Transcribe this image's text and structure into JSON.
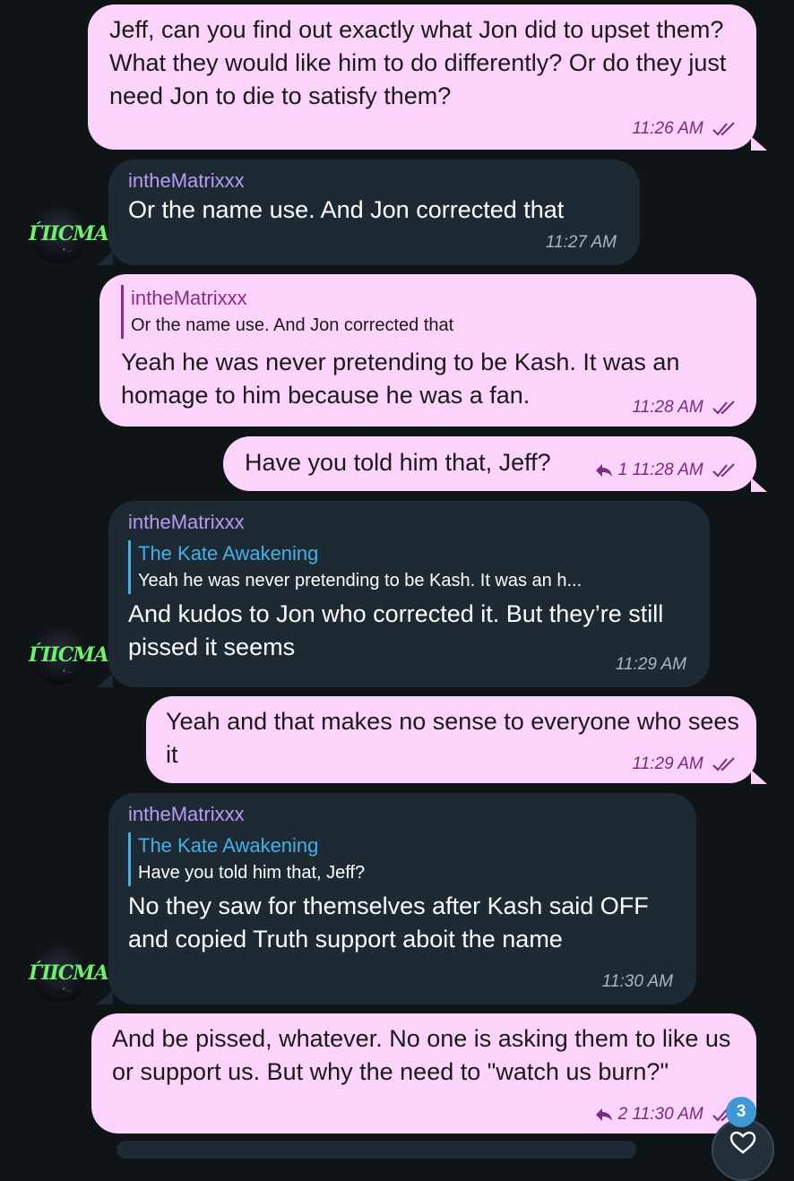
{
  "messages": [
    {
      "text": "Jeff, can you find out exactly what Jon did to upset them? What they would like him to do differently? Or do they just need Jon to die to satisfy them?",
      "time": "11:26 AM"
    },
    {
      "sender": "intheMatrixxx",
      "text": "Or the name use. And Jon corrected that",
      "time": "11:27 AM"
    },
    {
      "quote_name": "intheMatrixxx",
      "quote_text": "Or the name use. And Jon corrected that",
      "text": "Yeah he was never pretending to be Kash. It was an homage to him because he was a fan.",
      "time": "11:28 AM"
    },
    {
      "text": "Have you told him that, Jeff?",
      "replies": "1",
      "time": "11:28 AM"
    },
    {
      "sender": "intheMatrixxx",
      "quote_name": "The Kate Awakening",
      "quote_text": "Yeah he was never pretending to be Kash. It was an h...",
      "text": "And kudos to Jon who corrected it. But they’re still pissed it seems",
      "time": "11:29 AM"
    },
    {
      "text": "Yeah and that makes no sense to everyone who sees it",
      "time": "11:29 AM"
    },
    {
      "sender": "intheMatrixxx",
      "quote_name": "The Kate Awakening",
      "quote_text": "Have you told him that, Jeff?",
      "text": "No they saw for themselves after Kash said OFF and copied Truth support aboit the name",
      "time": "11:30 AM"
    },
    {
      "text": "And be pissed, whatever. No one is asking them to like us or support us. But why the need to \"watch us burn?\"",
      "replies": "2",
      "time": "11:30 AM"
    }
  ],
  "avatar_label": "ЃIIСMA",
  "unread_badge": "3",
  "icons": {
    "read": "double-check-icon",
    "reply": "reply-arrow-icon",
    "reaction": "heart-icon"
  }
}
